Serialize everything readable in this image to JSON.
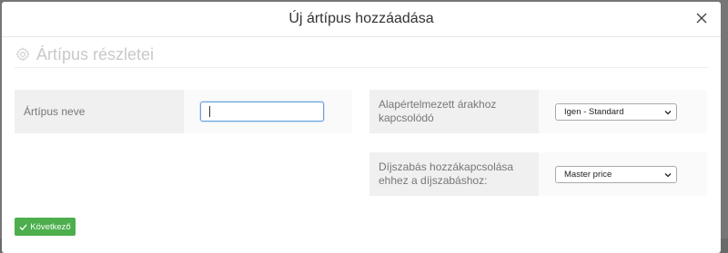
{
  "modal": {
    "title": "Új ártípus hozzáadása",
    "section_title": "Ártípus részletei"
  },
  "fields": {
    "name": {
      "label": "Ártípus neve",
      "value": ""
    },
    "default_prices": {
      "label": "Alapértelmezett árakhoz kapcsolódó",
      "selected": "Igen - Standard"
    },
    "pricing_link": {
      "label": "Díjszabás hozzákapcsolása ehhez a díjszabáshoz:",
      "selected": "Master price"
    }
  },
  "actions": {
    "next_label": "Következő"
  },
  "icons": {
    "close": "close-icon",
    "section": "gear-icon",
    "select_arrow": "chevron-down-icon",
    "next": "check-icon"
  },
  "colors": {
    "primary_button": "#4cae4c",
    "focus_border": "#6aa3dd"
  }
}
